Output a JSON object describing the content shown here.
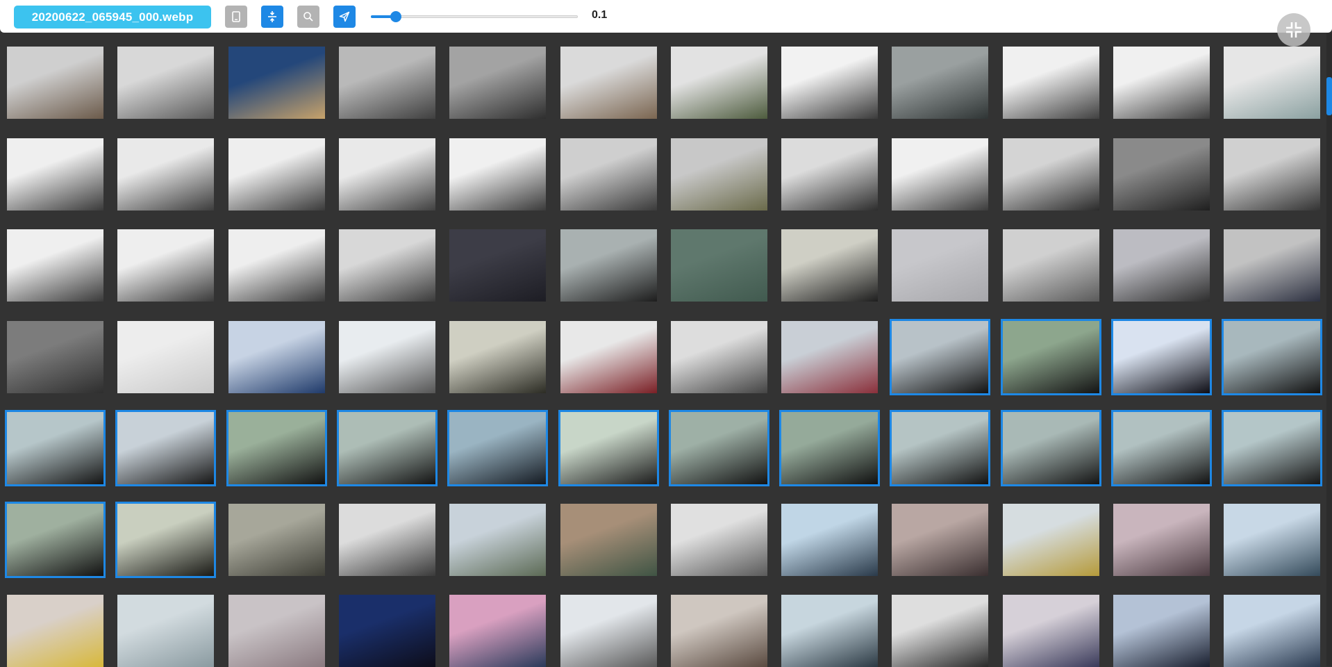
{
  "toolbar": {
    "filename": "20200622_065945_000.webp",
    "buttons": [
      {
        "name": "phone-view-button",
        "icon": "phone-icon",
        "style": "gray"
      },
      {
        "name": "expand-vertical-button",
        "icon": "expand-vertical-icon",
        "style": "blue"
      },
      {
        "name": "search-button",
        "icon": "search-icon",
        "style": "gray"
      },
      {
        "name": "send-button",
        "icon": "send-icon",
        "style": "blue"
      }
    ],
    "slider": {
      "value_label": "0.1",
      "position_fraction": 0.12
    },
    "fullscreen_icon": "collapse-fullscreen-icon"
  },
  "colors": {
    "accent": "#1e88e5",
    "badge": "#3cc3ef",
    "background": "#333333",
    "selection_border": "#1e88e5"
  },
  "scrollbar": {
    "position_fraction": 0.07,
    "visible_fraction": 0.06
  },
  "grid": {
    "columns": 12,
    "rows": [
      {
        "thumbs": [
          {
            "scene": "indoor-hallway",
            "colors": [
              "#cfcfcf",
              "#6b5a4a"
            ]
          },
          {
            "scene": "kitchen-person",
            "colors": [
              "#d8d8d8",
              "#5a5a5a"
            ]
          },
          {
            "scene": "wood-floor",
            "colors": [
              "#24477a",
              "#c7a26a"
            ]
          },
          {
            "scene": "kitchen-person",
            "colors": [
              "#b9b9b9",
              "#3f3f3f"
            ]
          },
          {
            "scene": "kitchen-dark",
            "colors": [
              "#a3a3a3",
              "#2e2e2e"
            ]
          },
          {
            "scene": "kitchen-person",
            "colors": [
              "#dadada",
              "#7a6550"
            ]
          },
          {
            "scene": "patio-doors",
            "colors": [
              "#e2e2e2",
              "#4d5b3d"
            ]
          },
          {
            "scene": "skylight",
            "colors": [
              "#f2f2f2",
              "#3a3a3a"
            ]
          },
          {
            "scene": "mug-closeup",
            "colors": [
              "#9aa0a0",
              "#2f3535"
            ]
          },
          {
            "scene": "skylight",
            "colors": [
              "#f0f0f0",
              "#404040"
            ]
          },
          {
            "scene": "skylight",
            "colors": [
              "#f0f0f0",
              "#3d3d3d"
            ]
          },
          {
            "scene": "mug-closeup",
            "colors": [
              "#e6e6e6",
              "#8aa0a0"
            ]
          }
        ]
      },
      {
        "thumbs": [
          {
            "scene": "skylight",
            "colors": [
              "#efefef",
              "#3a3a3a"
            ]
          },
          {
            "scene": "skylight-hand",
            "colors": [
              "#e9e9e9",
              "#3c3c3c"
            ]
          },
          {
            "scene": "skylight",
            "colors": [
              "#eeeeee",
              "#3a3a3a"
            ]
          },
          {
            "scene": "skylight",
            "colors": [
              "#e9e9e9",
              "#404040"
            ]
          },
          {
            "scene": "skylight",
            "colors": [
              "#f0f0f0",
              "#3a3a3a"
            ]
          },
          {
            "scene": "kitchen-person",
            "colors": [
              "#cfcfcf",
              "#3a3a3a"
            ]
          },
          {
            "scene": "fridge",
            "colors": [
              "#c8c8c8",
              "#6a6a4a"
            ]
          },
          {
            "scene": "tv-wall",
            "colors": [
              "#dcdcdc",
              "#2d2d2d"
            ]
          },
          {
            "scene": "skylight",
            "colors": [
              "#f0f0f0",
              "#3b3b3b"
            ]
          },
          {
            "scene": "kitchen-window",
            "colors": [
              "#d4d4d4",
              "#2b2b2b"
            ]
          },
          {
            "scene": "dark-room",
            "colors": [
              "#8a8a8a",
              "#1f1f1f"
            ]
          },
          {
            "scene": "kitchen-counter",
            "colors": [
              "#d0d0d0",
              "#333333"
            ]
          }
        ]
      },
      {
        "thumbs": [
          {
            "scene": "skylight",
            "colors": [
              "#efefef",
              "#3a3a3a"
            ]
          },
          {
            "scene": "skylight",
            "colors": [
              "#eeeeee",
              "#3a3a3a"
            ]
          },
          {
            "scene": "skylight",
            "colors": [
              "#eeeeee",
              "#3a3a3a"
            ]
          },
          {
            "scene": "kitchen-person",
            "colors": [
              "#d8d8d8",
              "#3a3a3a"
            ]
          },
          {
            "scene": "door-dark",
            "colors": [
              "#3d3d47",
              "#1d1d24"
            ]
          },
          {
            "scene": "window-sill",
            "colors": [
              "#a9b1b1",
              "#1d1d1d"
            ]
          },
          {
            "scene": "green-wall",
            "colors": [
              "#5f786d",
              "#415a4f"
            ]
          },
          {
            "scene": "monitor",
            "colors": [
              "#cfcfc5",
              "#1e1e1e"
            ]
          },
          {
            "scene": "bedroom",
            "colors": [
              "#c7c7cb",
              "#a7a7ab"
            ]
          },
          {
            "scene": "bedroom-window",
            "colors": [
              "#d0d0d0",
              "#5a5a5a"
            ]
          },
          {
            "scene": "kitchen-person",
            "colors": [
              "#bcbcc2",
              "#2e2e2e"
            ]
          },
          {
            "scene": "sofa",
            "colors": [
              "#c2c2c2",
              "#2c3040"
            ]
          }
        ]
      },
      {
        "thumbs": [
          {
            "scene": "door-dark",
            "colors": [
              "#7c7c7c",
              "#2e2e2e"
            ]
          },
          {
            "scene": "bathroom",
            "colors": [
              "#ededed",
              "#c9c9c9"
            ]
          },
          {
            "scene": "curtain",
            "colors": [
              "#c7d3e4",
              "#1f3a6a"
            ]
          },
          {
            "scene": "window-sill",
            "colors": [
              "#e8ecef",
              "#555555"
            ]
          },
          {
            "scene": "door-dark",
            "colors": [
              "#cfcfc2",
              "#2c2c24"
            ]
          },
          {
            "scene": "stairs",
            "colors": [
              "#e8e8e8",
              "#7a1f25"
            ]
          },
          {
            "scene": "hallway",
            "colors": [
              "#dddddd",
              "#444444"
            ]
          },
          {
            "scene": "street-flowers",
            "colors": [
              "#c9cfd6",
              "#8a2f3a"
            ]
          },
          {
            "scene": "car-windshield",
            "colors": [
              "#b8c2c8",
              "#131313"
            ],
            "selected": true
          },
          {
            "scene": "car-windshield-trees",
            "colors": [
              "#8da68d",
              "#141414"
            ],
            "selected": true
          },
          {
            "scene": "car-dark",
            "colors": [
              "#d9e2f0",
              "#0e0e16"
            ],
            "selected": true
          },
          {
            "scene": "car-windshield",
            "colors": [
              "#a8b8bd",
              "#121212"
            ],
            "selected": true
          }
        ]
      },
      {
        "thumbs": [
          {
            "scene": "car-windshield-trees",
            "colors": [
              "#b6c6c9",
              "#141414"
            ],
            "selected": true
          },
          {
            "scene": "car-windshield",
            "colors": [
              "#c8d1d8",
              "#161616"
            ],
            "selected": true
          },
          {
            "scene": "car-windshield-trees",
            "colors": [
              "#9ab09a",
              "#121212"
            ],
            "selected": true
          },
          {
            "scene": "car-windshield",
            "colors": [
              "#adbdb6",
              "#131313"
            ],
            "selected": true
          },
          {
            "scene": "car-windshield-trees",
            "colors": [
              "#9ab4c2",
              "#141a22"
            ],
            "selected": true
          },
          {
            "scene": "car-windshield-trees",
            "colors": [
              "#c8d6c8",
              "#1c1c1c"
            ],
            "selected": true
          },
          {
            "scene": "car-windshield",
            "colors": [
              "#9eb0a6",
              "#121212"
            ],
            "selected": true
          },
          {
            "scene": "car-windshield",
            "colors": [
              "#95aa9a",
              "#101010"
            ],
            "selected": true
          },
          {
            "scene": "car-windshield",
            "colors": [
              "#b5c4c4",
              "#121212"
            ],
            "selected": true
          },
          {
            "scene": "car-windshield",
            "colors": [
              "#a9b9b6",
              "#141414"
            ],
            "selected": true
          },
          {
            "scene": "car-windshield",
            "colors": [
              "#b1c1c1",
              "#121212"
            ],
            "selected": true
          },
          {
            "scene": "car-windshield-trees",
            "colors": [
              "#b4c6c8",
              "#161616"
            ],
            "selected": true
          }
        ]
      },
      {
        "thumbs": [
          {
            "scene": "car-windshield",
            "colors": [
              "#9fb09f",
              "#121212"
            ],
            "selected": true
          },
          {
            "scene": "car-interior-light",
            "colors": [
              "#c9cfbf",
              "#1a1a16"
            ],
            "selected": true
          },
          {
            "scene": "parking-structure",
            "colors": [
              "#a7a79a",
              "#3e3e36"
            ]
          },
          {
            "scene": "parking-lot",
            "colors": [
              "#dcdcdc",
              "#3a3a3a"
            ]
          },
          {
            "scene": "building-exterior",
            "colors": [
              "#c8d2da",
              "#5c6a55"
            ]
          },
          {
            "scene": "blurry-steps",
            "colors": [
              "#a78f78",
              "#3f5444"
            ]
          },
          {
            "scene": "corridor",
            "colors": [
              "#e0e0e0",
              "#5a5a5a"
            ]
          },
          {
            "scene": "office-window",
            "colors": [
              "#c0d6e6",
              "#2a3a4a"
            ]
          },
          {
            "scene": "blur-warm",
            "colors": [
              "#b9a7a3",
              "#3a2f30"
            ]
          },
          {
            "scene": "office-door",
            "colors": [
              "#d6dde0",
              "#b59a3a"
            ]
          },
          {
            "scene": "blur-pink",
            "colors": [
              "#c9b5bd",
              "#4a3a40"
            ]
          },
          {
            "scene": "office-window",
            "colors": [
              "#c8d8e6",
              "#344a5a"
            ]
          }
        ]
      },
      {
        "thumbs": [
          {
            "scene": "yellow-wall",
            "colors": [
              "#d9d0c9",
              "#d8b83a"
            ]
          },
          {
            "scene": "wall-grey",
            "colors": [
              "#d2dbdf",
              "#8a9aa0"
            ]
          },
          {
            "scene": "ceiling-light",
            "colors": [
              "#c9c3c6",
              "#8a7a80"
            ]
          },
          {
            "scene": "screen-blue",
            "colors": [
              "#1a2f6a",
              "#0d0d1a"
            ]
          },
          {
            "scene": "screen-colorful",
            "colors": [
              "#d9a0c0",
              "#2a3a5a"
            ]
          },
          {
            "scene": "office-window",
            "colors": [
              "#e2e6ea",
              "#5a5a5a"
            ]
          },
          {
            "scene": "corridor",
            "colors": [
              "#cfc7c0",
              "#5a4a40"
            ]
          },
          {
            "scene": "office-window",
            "colors": [
              "#c7d6de",
              "#2c3a44"
            ]
          },
          {
            "scene": "wall-grey",
            "colors": [
              "#dedede",
              "#2a2a2a"
            ]
          },
          {
            "scene": "corridor",
            "colors": [
              "#d6d0d8",
              "#3a3a5a"
            ]
          },
          {
            "scene": "person-laptop",
            "colors": [
              "#b4c2d6",
              "#1a2030"
            ]
          },
          {
            "scene": "screen-desk",
            "colors": [
              "#c6d6e6",
              "#2a3a50"
            ]
          }
        ]
      }
    ]
  }
}
